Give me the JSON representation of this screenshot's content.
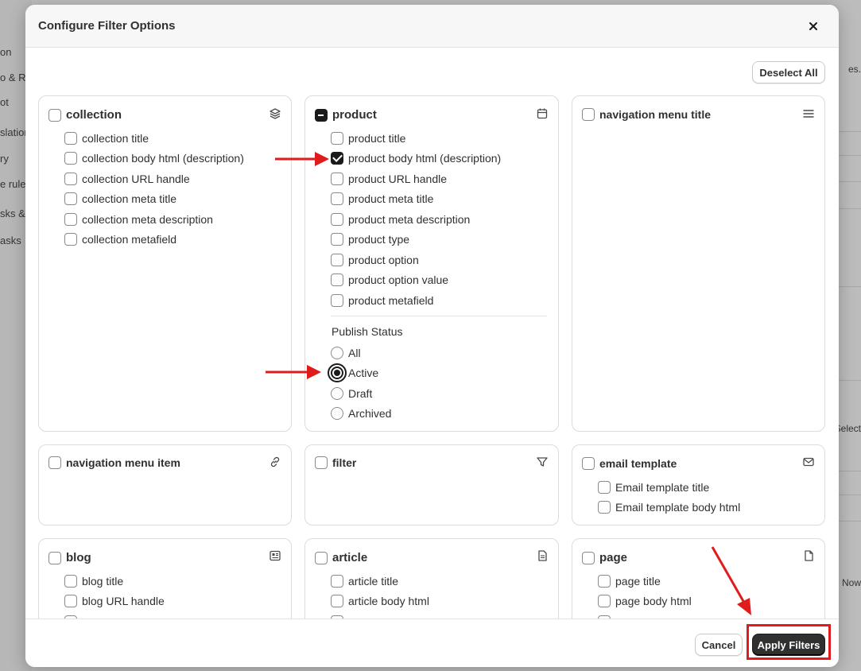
{
  "background": {
    "sidebar_fragments": [
      "on",
      "o & Re",
      "ot",
      "slation",
      "ry",
      "e rule",
      "sks &",
      "asks"
    ],
    "right_fragments": [
      "es.",
      "Select",
      "e Now"
    ]
  },
  "modal": {
    "title": "Configure Filter Options",
    "deselect_all_label": "Deselect All",
    "cancel_label": "Cancel",
    "apply_label": "Apply Filters"
  },
  "cards": {
    "collection": {
      "title": "collection",
      "icon": "layers-icon",
      "options": [
        "collection title",
        "collection body html (description)",
        "collection URL handle",
        "collection meta title",
        "collection meta description",
        "collection metafield"
      ]
    },
    "product": {
      "title": "product",
      "icon": "calendar-icon",
      "options": [
        "product title",
        "product body html (description)",
        "product URL handle",
        "product meta title",
        "product meta description",
        "product type",
        "product option",
        "product option value",
        "product metafield"
      ],
      "checked_option": "product body html (description)",
      "publish_status_label": "Publish Status",
      "publish_status_options": [
        "All",
        "Active",
        "Draft",
        "Archived"
      ],
      "publish_status_selected": "Active"
    },
    "navigation_menu_title": {
      "title": "navigation menu title",
      "icon": "menu-icon"
    },
    "navigation_menu_item": {
      "title": "navigation menu item",
      "icon": "link-icon"
    },
    "filter": {
      "title": "filter",
      "icon": "filter-icon"
    },
    "email_template": {
      "title": "email template",
      "icon": "mail-icon",
      "options": [
        "Email template title",
        "Email template body html"
      ]
    },
    "blog": {
      "title": "blog",
      "icon": "newspaper-icon",
      "options": [
        "blog title",
        "blog URL handle"
      ]
    },
    "article": {
      "title": "article",
      "icon": "document-icon",
      "options": [
        "article title",
        "article body html"
      ]
    },
    "page": {
      "title": "page",
      "icon": "page-icon",
      "options": [
        "page title",
        "page body html"
      ]
    }
  },
  "colors": {
    "accent": "#303030",
    "annotation": "#e01b1b"
  }
}
